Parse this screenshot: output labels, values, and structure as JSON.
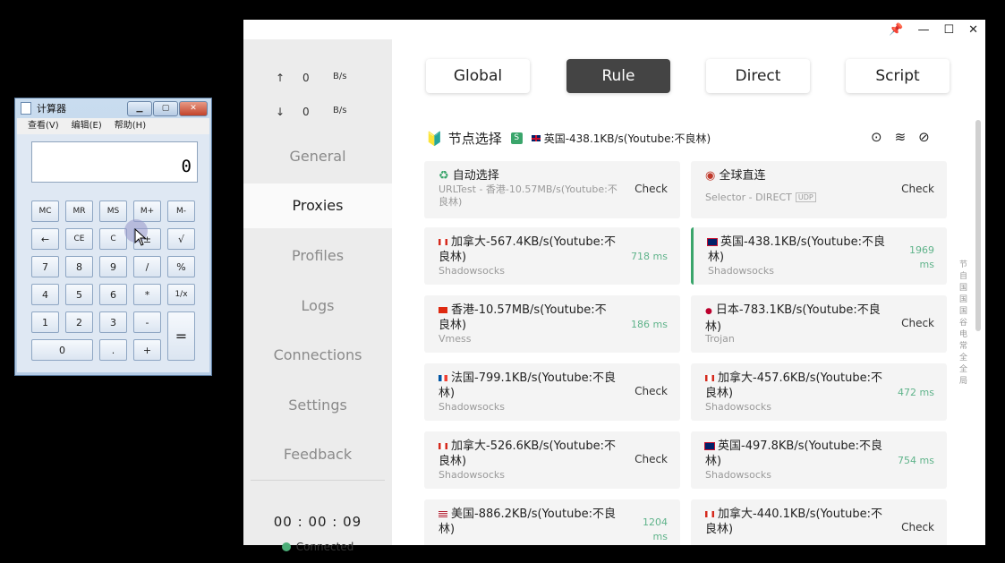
{
  "calculator": {
    "title": "计算器",
    "menu": [
      "查看(V)",
      "编辑(E)",
      "帮助(H)"
    ],
    "display": "0",
    "keys": [
      "MC",
      "MR",
      "MS",
      "M+",
      "M-",
      "←",
      "CE",
      "C",
      "±",
      "√",
      "7",
      "8",
      "9",
      "/",
      "%",
      "4",
      "5",
      "6",
      "*",
      "1/x",
      "1",
      "2",
      "3",
      "-",
      "=",
      "0",
      ".",
      "+"
    ]
  },
  "traffic": {
    "up_arrow": "↑",
    "up_value": "0",
    "up_unit": "B/s",
    "down_arrow": "↓",
    "down_value": "0",
    "down_unit": "B/s"
  },
  "nav": [
    "General",
    "Proxies",
    "Profiles",
    "Logs",
    "Connections",
    "Settings",
    "Feedback"
  ],
  "active_nav": "Proxies",
  "status": {
    "timer": "00 : 00 : 09",
    "connection": "Connected"
  },
  "modes": [
    "Global",
    "Rule",
    "Direct",
    "Script"
  ],
  "active_mode": "Rule",
  "group": {
    "name": "节点选择",
    "badge": "S",
    "selected": "英国-438.1KB/s(Youtube:不良林)"
  },
  "proxies": [
    {
      "name": "自动选择",
      "type": "URLTest - 香港-10.57MB/s(Youtube:不良林)",
      "action": "Check",
      "latency": ""
    },
    {
      "name": "全球直连",
      "type": "Selector - DIRECT",
      "udp": "UDP",
      "action": "Check",
      "latency": ""
    },
    {
      "name": "加拿大-567.4KB/s(Youtube:不良林)",
      "type": "Shadowsocks",
      "action": "",
      "latency": "718 ms"
    },
    {
      "name": "英国-438.1KB/s(Youtube:不良林)",
      "type": "Shadowsocks",
      "action": "",
      "latency": "1969 ms",
      "selected": true
    },
    {
      "name": "香港-10.57MB/s(Youtube:不良林)",
      "type": "Vmess",
      "action": "",
      "latency": "186 ms"
    },
    {
      "name": "日本-783.1KB/s(Youtube:不良林)",
      "type": "Trojan",
      "action": "Check",
      "latency": ""
    },
    {
      "name": "法国-799.1KB/s(Youtube:不良林)",
      "type": "Shadowsocks",
      "action": "Check",
      "latency": ""
    },
    {
      "name": "加拿大-457.6KB/s(Youtube:不良林)",
      "type": "Shadowsocks",
      "action": "",
      "latency": "472 ms"
    },
    {
      "name": "加拿大-526.6KB/s(Youtube:不良林)",
      "type": "Shadowsocks",
      "action": "Check",
      "latency": ""
    },
    {
      "name": "英国-497.8KB/s(Youtube:不良林)",
      "type": "Shadowsocks",
      "action": "",
      "latency": "754 ms"
    },
    {
      "name": "美国-886.2KB/s(Youtube:不良林)",
      "type": "",
      "action": "",
      "latency": "1204 ms"
    },
    {
      "name": "加拿大-440.1KB/s(Youtube:不良林)",
      "type": "",
      "action": "Check",
      "latency": ""
    }
  ],
  "side_index": "节自国国国谷电常全全局",
  "colors": {
    "accent": "#3aa56b",
    "active_mode_bg": "#444444",
    "latency": "#5fb38a"
  }
}
